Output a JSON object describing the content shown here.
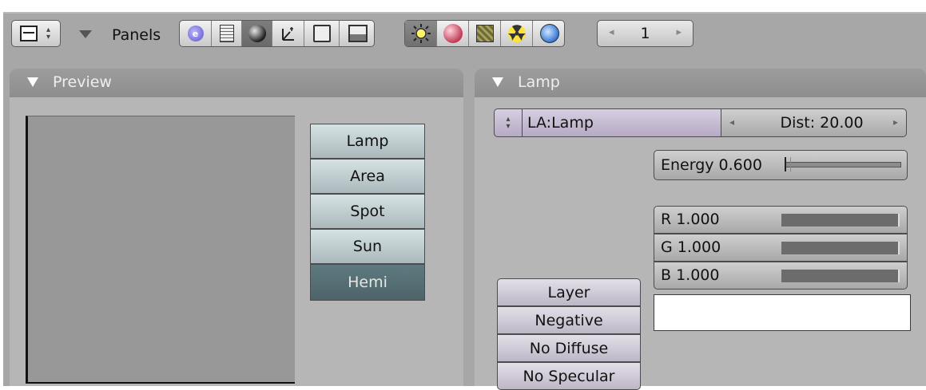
{
  "header": {
    "panels_label": "Panels",
    "frame_number": "1",
    "context_icons": [
      "logic-icon",
      "script-icon",
      "shading-sphere-icon",
      "object-axes-icon",
      "editing-icon",
      "scene-icon"
    ],
    "shading_icons": [
      "lamp-icon",
      "material-icon",
      "texture-icon",
      "radio-icon",
      "world-icon"
    ]
  },
  "preview": {
    "title": "Preview",
    "lamp_types": [
      "Lamp",
      "Area",
      "Spot",
      "Sun",
      "Hemi"
    ],
    "selected": "Hemi"
  },
  "lamp": {
    "title": "Lamp",
    "name": "LA:Lamp",
    "dist": "Dist: 20.00",
    "energy": "Energy 0.600",
    "energy_value": 0.6,
    "r": "R 1.000",
    "g": "G 1.000",
    "b": "B 1.000",
    "options": [
      "Layer",
      "Negative",
      "No Diffuse",
      "No Specular"
    ],
    "color_swatch": "#ffffff"
  },
  "colors": {
    "lamp_type_selected": "#566e73",
    "lamp_type": "#c4d2d5",
    "option_button": "#d2ccd9"
  }
}
